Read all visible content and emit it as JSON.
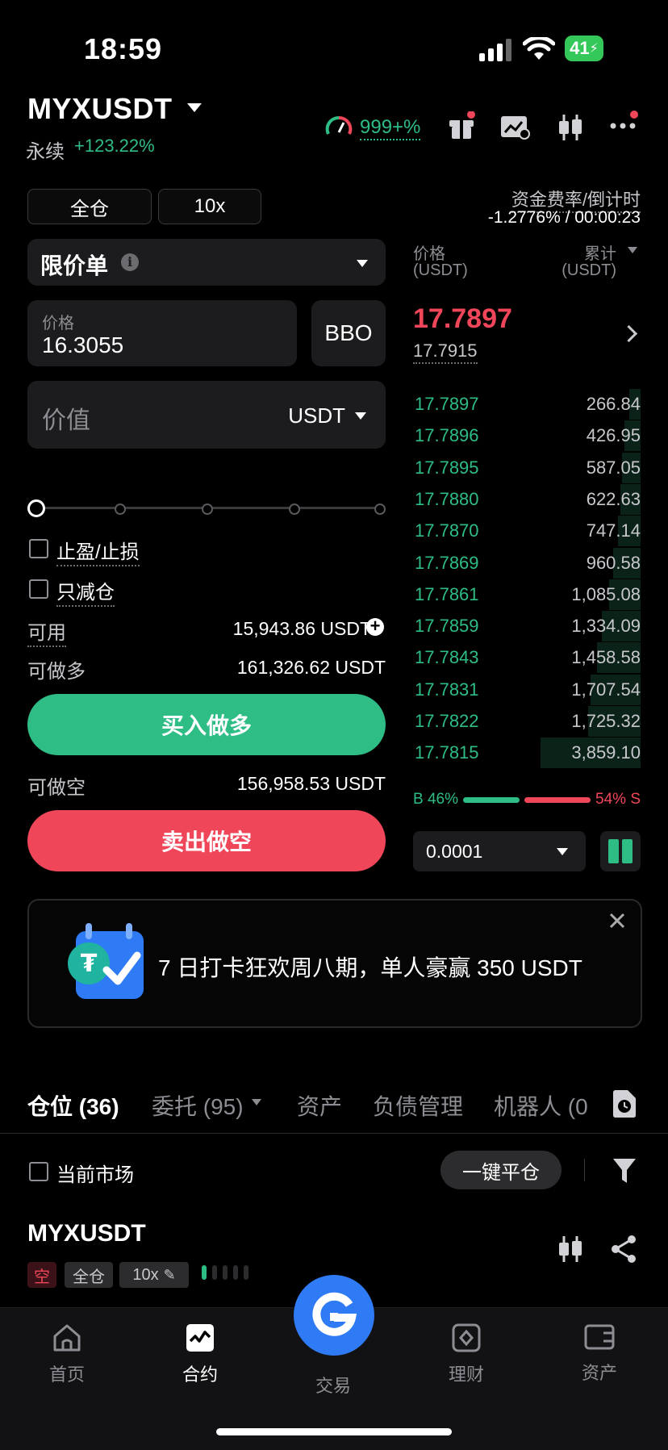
{
  "status_bar": {
    "time": "18:59",
    "battery": "41"
  },
  "header": {
    "symbol": "MYXUSDT",
    "contract_type": "永续",
    "change": "+123.22%",
    "speed": "999+%"
  },
  "order_form": {
    "margin_mode": "全仓",
    "leverage": "10x",
    "order_type": "限价单",
    "price_label": "价格",
    "price_value": "16.3055",
    "bbo": "BBO",
    "value_placeholder": "价值",
    "value_unit": "USDT",
    "tp_sl": "止盈/止损",
    "reduce_only": "只减仓",
    "available_label": "可用",
    "available_value": "15,943.86 USDT",
    "max_long_label": "可做多",
    "max_long_value": "161,326.62 USDT",
    "buy_label": "买入做多",
    "max_short_label": "可做空",
    "max_short_value": "156,958.53 USDT",
    "sell_label": "卖出做空"
  },
  "funding": {
    "title": "资金费率/倒计时",
    "value": "-1.2776% / 00:00:23"
  },
  "orderbook": {
    "price_header": "价格",
    "price_unit": "(USDT)",
    "sum_header": "累计",
    "sum_unit": "(USDT)",
    "last_price": "17.7897",
    "mark_price": "17.7915",
    "rows": [
      {
        "price": "17.7897",
        "amount": "266.84",
        "depth": 0.05
      },
      {
        "price": "17.7896",
        "amount": "426.95",
        "depth": 0.07
      },
      {
        "price": "17.7895",
        "amount": "587.05",
        "depth": 0.08
      },
      {
        "price": "17.7880",
        "amount": "622.63",
        "depth": 0.09
      },
      {
        "price": "17.7870",
        "amount": "747.14",
        "depth": 0.1
      },
      {
        "price": "17.7869",
        "amount": "960.58",
        "depth": 0.12
      },
      {
        "price": "17.7861",
        "amount": "1,085.08",
        "depth": 0.14
      },
      {
        "price": "17.7859",
        "amount": "1,334.09",
        "depth": 0.17
      },
      {
        "price": "17.7843",
        "amount": "1,458.58",
        "depth": 0.19
      },
      {
        "price": "17.7831",
        "amount": "1,707.54",
        "depth": 0.22
      },
      {
        "price": "17.7822",
        "amount": "1,725.32",
        "depth": 0.23
      },
      {
        "price": "17.7815",
        "amount": "3,859.10",
        "depth": 0.44
      }
    ],
    "buy_ratio_label": "B 46%",
    "sell_ratio_label": "54% S",
    "buy_ratio": 0.46,
    "precision": "0.0001"
  },
  "banner": {
    "text": "7 日打卡狂欢周八期，单人豪赢 350 USDT"
  },
  "tabs": [
    "仓位 (36)",
    "委托 (95)",
    "资产",
    "负债管理",
    "机器人 (0"
  ],
  "filter": {
    "current_market": "当前市场",
    "close_all": "一键平仓"
  },
  "position": {
    "symbol": "MYXUSDT",
    "side": "空",
    "mode": "全仓",
    "leverage": "10x"
  },
  "bottom_nav": [
    {
      "label": "首页"
    },
    {
      "label": "合约"
    },
    {
      "label": "交易"
    },
    {
      "label": "理财"
    },
    {
      "label": "资产"
    }
  ],
  "colors": {
    "green": "#2ebd85",
    "red": "#f0465a",
    "accent_blue": "#2f7bf5"
  }
}
